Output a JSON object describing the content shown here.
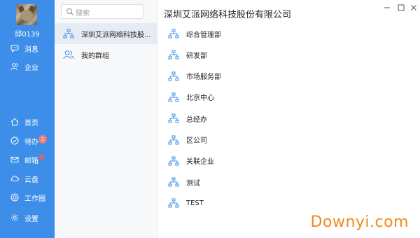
{
  "user": {
    "name": "邱0139"
  },
  "rail": {
    "top_items": [
      {
        "label": "消息",
        "icon": "chat-icon"
      },
      {
        "label": "企业",
        "icon": "users-icon"
      }
    ],
    "bottom_items": [
      {
        "label": "首页",
        "icon": "home-icon"
      },
      {
        "label": "待办",
        "icon": "check-circle-icon",
        "badge": "1"
      },
      {
        "label": "邮箱",
        "icon": "mail-icon",
        "dot": true
      },
      {
        "label": "云盘",
        "icon": "cloud-icon"
      },
      {
        "label": "工作圈",
        "icon": "circle-icon"
      },
      {
        "label": "设置",
        "icon": "gear-icon"
      }
    ]
  },
  "search": {
    "placeholder": "搜索"
  },
  "sidebar": {
    "items": [
      {
        "label": "深圳艾派网络科技股...",
        "icon": "org-icon",
        "active": true
      },
      {
        "label": "我的群组",
        "icon": "group-icon",
        "active": false
      }
    ]
  },
  "main": {
    "title": "深圳艾派网络科技股份有限公司",
    "departments": [
      "综合管理部",
      "研发部",
      "市场服务部",
      "北京中心",
      "总经办",
      "区公司",
      "关联企业",
      "测试",
      "TEST"
    ]
  },
  "watermark": "Downyi.com",
  "colors": {
    "rail_bg": "#3d8ee8",
    "accent_icon": "#3d8ee8",
    "watermark": "#f08a1e"
  }
}
